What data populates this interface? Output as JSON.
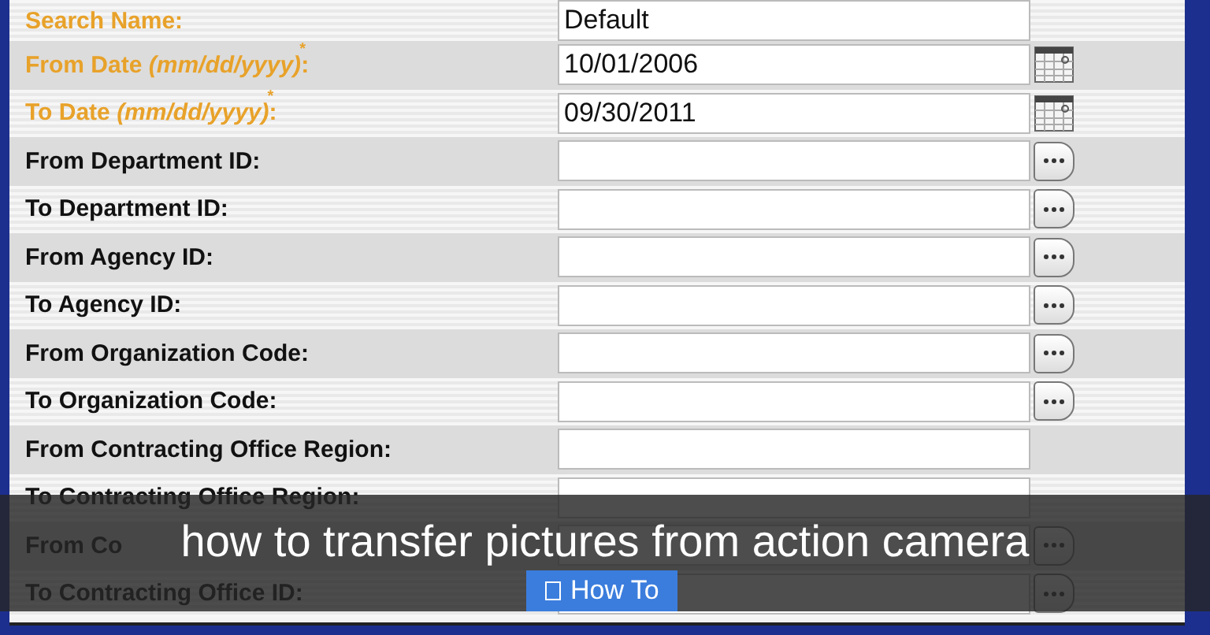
{
  "form": {
    "rows": [
      {
        "label": "Search Name:",
        "highlighted": true,
        "kind": "text",
        "value": "Default"
      },
      {
        "label": "From Date *(mm/dd/yyyy)*:",
        "highlighted": true,
        "marker": "*",
        "kind": "date",
        "value": "10/01/2006"
      },
      {
        "label": "To Date *(mm/dd/yyyy)*:",
        "highlighted": true,
        "marker": "*",
        "kind": "date",
        "value": "09/30/2011"
      },
      {
        "label": "From Department ID:",
        "highlighted": false,
        "kind": "lookup"
      },
      {
        "label": "To Department ID:",
        "highlighted": false,
        "kind": "lookup"
      },
      {
        "label": "From Agency ID:",
        "highlighted": false,
        "kind": "lookup"
      },
      {
        "label": "To Agency ID:",
        "highlighted": false,
        "kind": "lookup"
      },
      {
        "label": "From Organization Code:",
        "highlighted": false,
        "kind": "lookup"
      },
      {
        "label": "To Organization Code:",
        "highlighted": false,
        "kind": "lookup"
      },
      {
        "label": "From Contracting Office Region:",
        "highlighted": false,
        "kind": "text"
      },
      {
        "label": "To Contracting Office Region:",
        "highlighted": false,
        "kind": "text"
      },
      {
        "label": "From Co",
        "highlighted": false,
        "kind": "lookup"
      },
      {
        "label": "To Contracting Office ID:",
        "highlighted": false,
        "kind": "lookup"
      }
    ]
  },
  "overlay": {
    "caption": "how to transfer pictures from action camera",
    "button": "How To"
  }
}
